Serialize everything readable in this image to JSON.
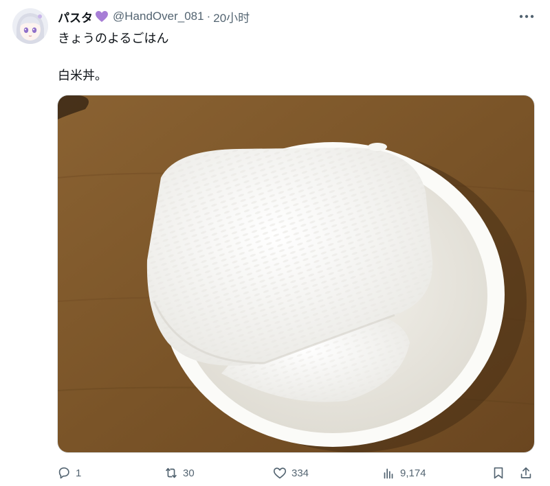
{
  "tweet": {
    "display_name": "パスタ",
    "handle": "@HandOver_081",
    "separator": "·",
    "time": "20小时",
    "text_line1": "きょうのよるごはん",
    "text_line2": "白米丼。"
  },
  "icons": {
    "heart_badge": "purple-heart-emoji",
    "more": "more-dots-icon",
    "reply": "reply-icon",
    "retweet": "retweet-icon",
    "like": "like-icon",
    "views": "views-icon",
    "bookmark": "bookmark-icon",
    "share": "share-icon"
  },
  "stats": {
    "replies": "1",
    "retweets": "30",
    "likes": "334",
    "views": "9,174"
  },
  "colors": {
    "text_primary": "#0f1419",
    "text_secondary": "#536471",
    "heart_badge": "#a77ed6"
  }
}
